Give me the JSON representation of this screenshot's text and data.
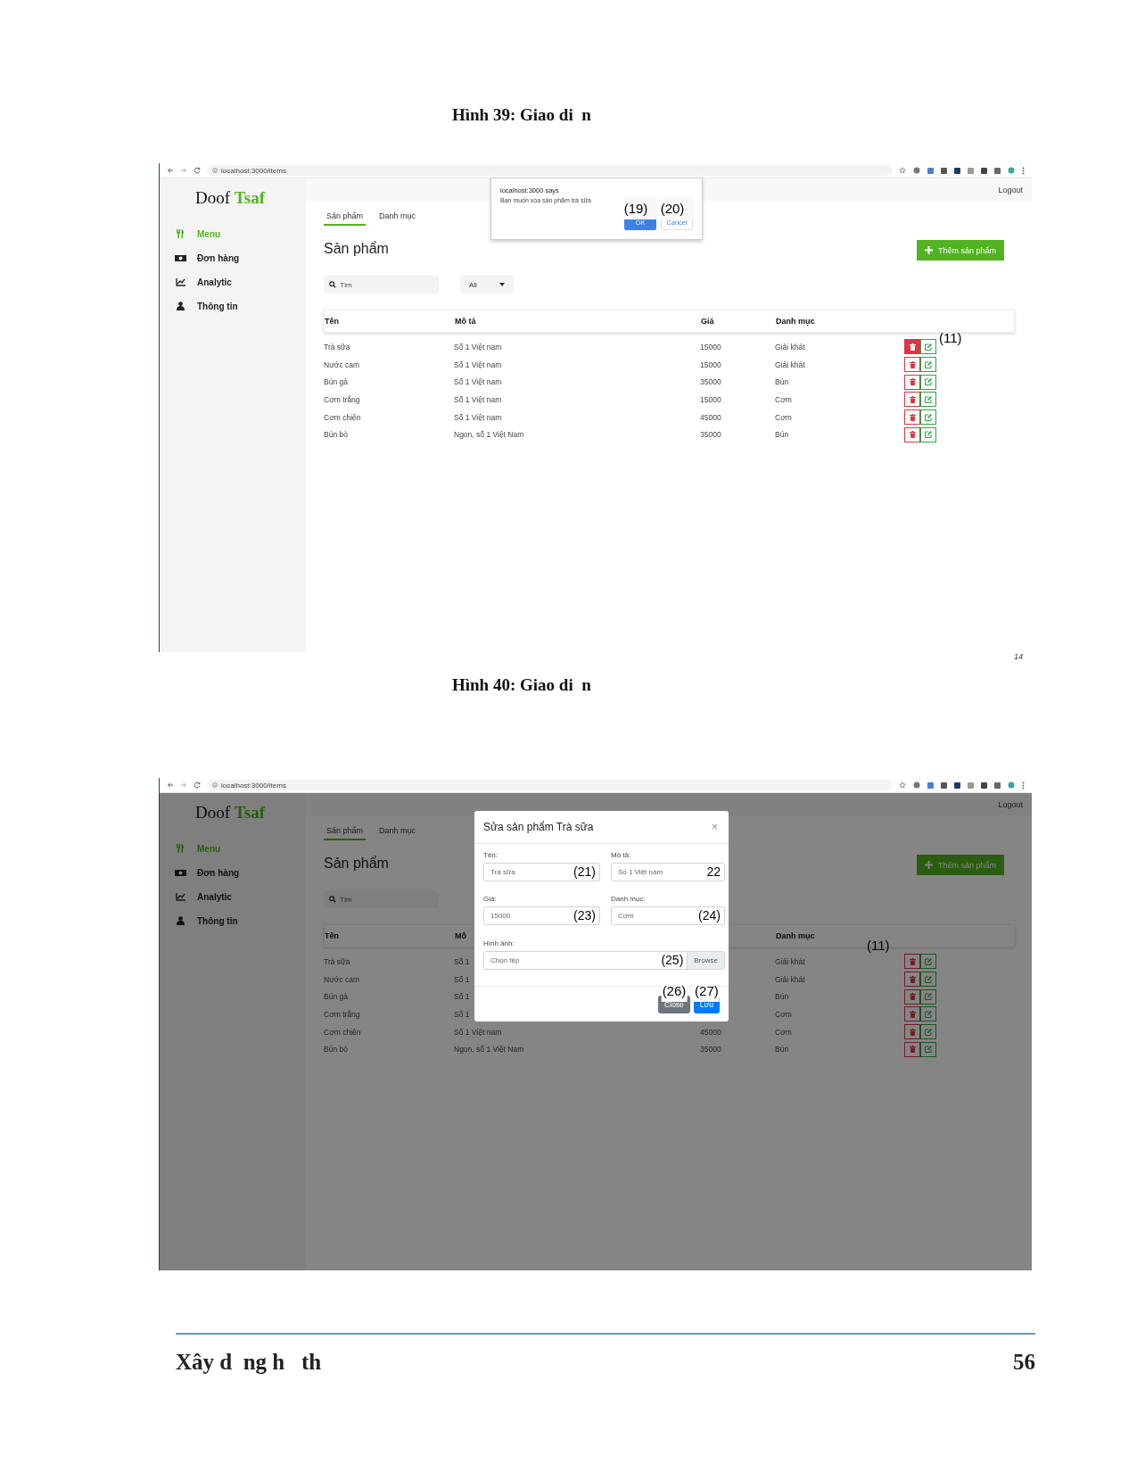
{
  "figures": [
    {
      "caption": "Hình 39: Giao di  n",
      "screenshot": {
        "browser": {
          "url": "localhost:3000/items"
        },
        "brand": {
          "first": "Doof",
          "second": "Tsaf"
        },
        "sidebar": [
          {
            "label": "Menu",
            "kind": "utensils",
            "selected": true
          },
          {
            "label": "Đơn hàng",
            "kind": "money",
            "selected": false
          },
          {
            "label": "Analytic",
            "kind": "chart",
            "selected": false
          },
          {
            "label": "Thông tin",
            "kind": "user",
            "selected": false
          }
        ],
        "logout": "Logout",
        "tabs": [
          {
            "label": "Sản phẩm",
            "selected": true
          },
          {
            "label": "Danh mục",
            "selected": false
          }
        ],
        "heading": "Sản phẩm",
        "add_button": "Thêm sản phẩm",
        "search": {
          "placeholder": "Tìm"
        },
        "filter": {
          "value": "All"
        },
        "table": {
          "columns": {
            "name": "Tên",
            "description": "Mô tả",
            "price": "Giá",
            "category": "Danh mục"
          },
          "rows": [
            {
              "name": "Trà sữa",
              "description": "Số 1 Việt nam",
              "price": "15000",
              "category": "Giải khát",
              "delete_pressed": true,
              "callout": {
                "kind": "over",
                "text": "(11)"
              }
            },
            {
              "name": "Nước cam",
              "description": "Số 1 Việt nam",
              "price": "15000",
              "category": "Giải khát",
              "delete_pressed": false
            },
            {
              "name": "Bún gà",
              "description": "Số 1 Việt nam",
              "price": "35000",
              "category": "Bún",
              "delete_pressed": false
            },
            {
              "name": "Cơm trắng",
              "description": "Số 1 Việt nam",
              "price": "15000",
              "category": "Cơm",
              "delete_pressed": false
            },
            {
              "name": "Cơm chiên",
              "description": "Số 1 Việt nam",
              "price": "45000",
              "category": "Cơm",
              "delete_pressed": false
            },
            {
              "name": "Bún bò",
              "description": "Ngon, số 1 Việt Nam",
              "price": "35000",
              "category": "Bún",
              "delete_pressed": false
            }
          ]
        },
        "overlay": {
          "kind": "alert",
          "origin": "localhost:3000 says",
          "message": "Bạn muốn xóa sản phẩm trà sữa",
          "buttons": [
            {
              "label": "OK",
              "primary": true,
              "callout": "(19)"
            },
            {
              "label": "Cancel",
              "primary": false,
              "callout": "(20)"
            }
          ]
        }
      },
      "corner_text": "14"
    },
    {
      "caption": "Hình 40: Giao di  n",
      "screenshot": {
        "browser": {
          "url": "localhost:3000/items"
        },
        "brand": {
          "first": "Doof",
          "second": "Tsaf"
        },
        "sidebar": [
          {
            "label": "Menu",
            "kind": "utensils",
            "selected": true
          },
          {
            "label": "Đơn hàng",
            "kind": "money",
            "selected": false
          },
          {
            "label": "Analytic",
            "kind": "chart",
            "selected": false
          },
          {
            "label": "Thông tin",
            "kind": "user",
            "selected": false
          }
        ],
        "logout": "Logout",
        "tabs": [
          {
            "label": "Sản phẩm",
            "selected": true
          },
          {
            "label": "Danh mục",
            "selected": false
          }
        ],
        "heading": "Sản phẩm",
        "add_button": "Thêm sản phẩm",
        "search": {
          "placeholder": "Tìm"
        },
        "table": {
          "columns": {
            "name": "Tên",
            "description": "Mô",
            "category": "Danh mục"
          },
          "rows": [
            {
              "name": "Trà sữa",
              "description": "Số 1",
              "category": "Giải khát",
              "delete_pressed": false,
              "callout": {
                "kind": "left",
                "text": "(11)"
              }
            },
            {
              "name": "Nước cam",
              "description": "Số 1",
              "category": "Giải khát",
              "delete_pressed": false
            },
            {
              "name": "Bún gà",
              "description": "Số 1",
              "category": "Bún",
              "delete_pressed": false
            },
            {
              "name": "Cơm trắng",
              "description": "Số 1",
              "category": "Cơm",
              "delete_pressed": false
            },
            {
              "name": "Cơm chiên",
              "description": "Số 1 Việt nam",
              "price": "45000",
              "category": "Cơm",
              "delete_pressed": false
            },
            {
              "name": "Bún bò",
              "description": "Ngon, số 1 Việt Nam",
              "price": "35000",
              "category": "Bún",
              "delete_pressed": false
            }
          ]
        },
        "overlay": {
          "kind": "modal",
          "title": "Sửa sản phẩm Trà sữa",
          "close": "×",
          "fields": [
            {
              "kind": "text",
              "label": "Tên:",
              "value": "Trà sữa",
              "callout": "(21)"
            },
            {
              "kind": "text",
              "label": "Mô tả:",
              "value": "Số 1 Việt nam",
              "callout": "22"
            },
            {
              "kind": "text",
              "label": "Giá:",
              "value": "15000",
              "callout": "(23)"
            },
            {
              "kind": "text",
              "label": "Danh mục:",
              "value": "Cơm",
              "callout": "(24)"
            },
            {
              "kind": "file",
              "label": "Hình ảnh:",
              "value": "Chọn tệp",
              "button": "Browse",
              "callout": "(25)"
            }
          ],
          "buttons": [
            {
              "label": "Close",
              "primary": false,
              "callout": "(26)"
            },
            {
              "label": "Lưu",
              "primary": true,
              "callout": "(27)"
            }
          ]
        }
      }
    }
  ],
  "footer": {
    "title": "Xây d  ng h   th",
    "page": "56"
  }
}
